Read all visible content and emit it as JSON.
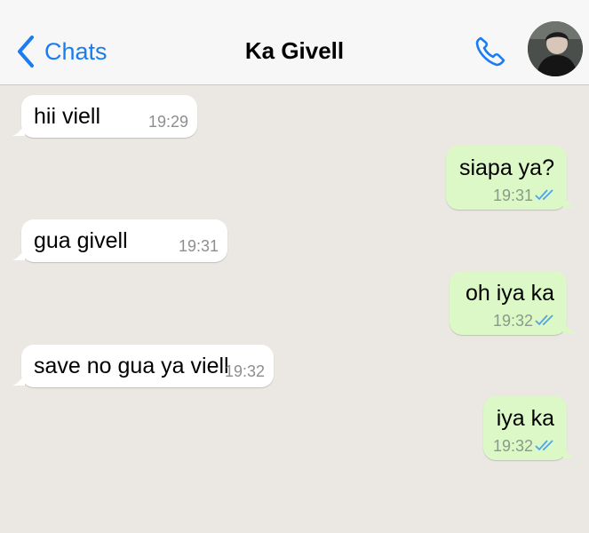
{
  "header": {
    "back_label": "Chats",
    "contact_name": "Ka Givell",
    "accent_color": "#1a7cf2"
  },
  "messages": [
    {
      "direction": "in",
      "text": "hii viell",
      "time": "19:29"
    },
    {
      "direction": "out",
      "text": "siapa ya?",
      "time": "19:31",
      "status": "read"
    },
    {
      "direction": "in",
      "text": "gua givell",
      "time": "19:31"
    },
    {
      "direction": "out",
      "text": "oh iya ka",
      "time": "19:32",
      "status": "read"
    },
    {
      "direction": "in",
      "text": "save no gua ya viell",
      "time": "19:32"
    },
    {
      "direction": "out",
      "text": "iya ka",
      "time": "19:32",
      "status": "read"
    }
  ],
  "colors": {
    "incoming_bubble": "#ffffff",
    "outgoing_bubble": "#dcf8c6",
    "read_ticks": "#4fa3e8",
    "chat_background": "#ebe8e3"
  }
}
